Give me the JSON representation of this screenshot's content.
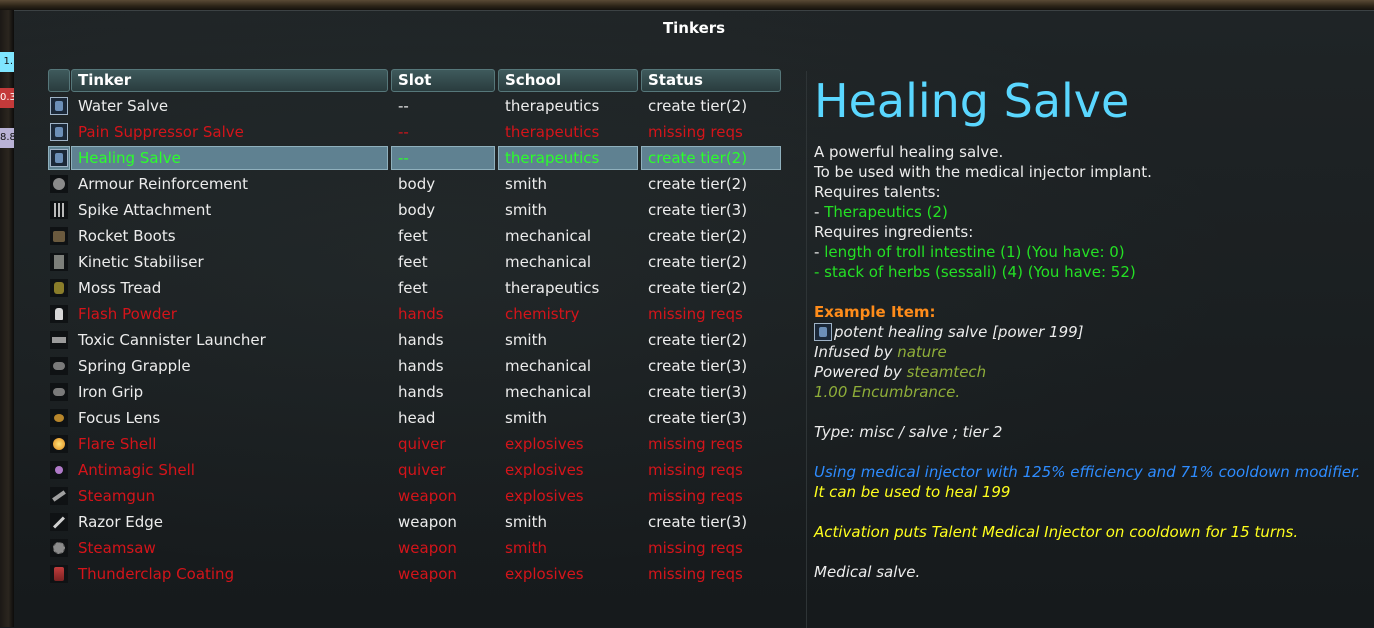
{
  "window": {
    "title": "Tinkers"
  },
  "left_edge_tags": [
    {
      "text": "1.",
      "color": "#7fe6ff"
    },
    {
      "text": "0.3",
      "color": "#c43a3a"
    },
    {
      "text": "8.8",
      "color": "#b9b2d6"
    }
  ],
  "table": {
    "headers": {
      "tinker": "Tinker",
      "slot": "Slot",
      "school": "School",
      "status": "Status"
    },
    "rows": [
      {
        "icon": "water-salve-icon",
        "style": "salve",
        "name": "Water Salve",
        "slot": "--",
        "school": "therapeutics",
        "status": "create tier(2)",
        "state": "normal"
      },
      {
        "icon": "pain-suppressor-salve-icon",
        "style": "salve",
        "name": "Pain Suppressor Salve",
        "slot": "--",
        "school": "therapeutics",
        "status": "missing reqs",
        "state": "missing"
      },
      {
        "icon": "healing-salve-icon",
        "style": "salve",
        "name": "Healing Salve",
        "slot": "--",
        "school": "therapeutics",
        "status": "create tier(2)",
        "state": "selected"
      },
      {
        "icon": "armour-reinforcement-icon",
        "style": "gear",
        "name": "Armour Reinforcement",
        "slot": "body",
        "school": "smith",
        "status": "create tier(2)",
        "state": "normal"
      },
      {
        "icon": "spike-attachment-icon",
        "style": "spike",
        "name": "Spike Attachment",
        "slot": "body",
        "school": "smith",
        "status": "create tier(3)",
        "state": "normal"
      },
      {
        "icon": "rocket-boots-icon",
        "style": "boots",
        "name": "Rocket Boots",
        "slot": "feet",
        "school": "mechanical",
        "status": "create tier(2)",
        "state": "normal"
      },
      {
        "icon": "kinetic-stabiliser-icon",
        "style": "kinetic",
        "name": "Kinetic Stabiliser",
        "slot": "feet",
        "school": "mechanical",
        "status": "create tier(2)",
        "state": "normal"
      },
      {
        "icon": "moss-tread-icon",
        "style": "moss",
        "name": "Moss Tread",
        "slot": "feet",
        "school": "therapeutics",
        "status": "create tier(2)",
        "state": "normal"
      },
      {
        "icon": "flash-powder-icon",
        "style": "powder",
        "name": "Flash Powder",
        "slot": "hands",
        "school": "chemistry",
        "status": "missing reqs",
        "state": "missing"
      },
      {
        "icon": "toxic-cannister-launcher-icon",
        "style": "launcher",
        "name": "Toxic Cannister Launcher",
        "slot": "hands",
        "school": "smith",
        "status": "create tier(2)",
        "state": "normal"
      },
      {
        "icon": "spring-grapple-icon",
        "style": "grapple",
        "name": "Spring Grapple",
        "slot": "hands",
        "school": "mechanical",
        "status": "create tier(3)",
        "state": "normal"
      },
      {
        "icon": "iron-grip-icon",
        "style": "grapple",
        "name": "Iron Grip",
        "slot": "hands",
        "school": "mechanical",
        "status": "create tier(3)",
        "state": "normal"
      },
      {
        "icon": "focus-lens-icon",
        "style": "lens",
        "name": "Focus Lens",
        "slot": "head",
        "school": "smith",
        "status": "create tier(3)",
        "state": "normal"
      },
      {
        "icon": "flare-shell-icon",
        "style": "flare",
        "name": "Flare Shell",
        "slot": "quiver",
        "school": "explosives",
        "status": "missing reqs",
        "state": "missing"
      },
      {
        "icon": "antimagic-shell-icon",
        "style": "antimagic",
        "name": "Antimagic Shell",
        "slot": "quiver",
        "school": "explosives",
        "status": "missing reqs",
        "state": "missing"
      },
      {
        "icon": "steamgun-icon",
        "style": "gun",
        "name": "Steamgun",
        "slot": "weapon",
        "school": "explosives",
        "status": "missing reqs",
        "state": "missing"
      },
      {
        "icon": "razor-edge-icon",
        "style": "blade",
        "name": "Razor Edge",
        "slot": "weapon",
        "school": "smith",
        "status": "create tier(3)",
        "state": "normal"
      },
      {
        "icon": "steamsaw-icon",
        "style": "saw",
        "name": "Steamsaw",
        "slot": "weapon",
        "school": "smith",
        "status": "missing reqs",
        "state": "missing"
      },
      {
        "icon": "thunderclap-coating-icon",
        "style": "thunder",
        "name": "Thunderclap Coating",
        "slot": "weapon",
        "school": "explosives",
        "status": "missing reqs",
        "state": "missing"
      }
    ]
  },
  "detail": {
    "title": "Healing Salve",
    "desc1": "A powerful healing salve.",
    "desc2": "To be used with the medical injector implant.",
    "req_talents_label": "Requires talents:",
    "talent_prefix": "- ",
    "talent": "Therapeutics (2)",
    "req_ingredients_label": "Requires ingredients:",
    "ingredient_prefix": "- ",
    "ingredient1": "length of troll intestine (1) (You have: 0)",
    "ingredient2": "- stack of herbs (sessali) (4) (You have: 52)",
    "example_label": "Example Item:",
    "example_name": "potent healing salve [power 199]",
    "infused_label": "Infused by ",
    "infused_value": "nature",
    "powered_label": "Powered by ",
    "powered_value": "steamtech",
    "encumbrance": "1.00 Encumbrance.",
    "type_line": "Type: misc / salve ; tier 2",
    "usage_line": "Using medical injector with 125% efficiency and 71% cooldown modifier.",
    "heal_line": "It can be used to heal 199",
    "activation_line": "Activation puts Talent Medical Injector on cooldown for 15 turns.",
    "footer": "Medical salve."
  }
}
